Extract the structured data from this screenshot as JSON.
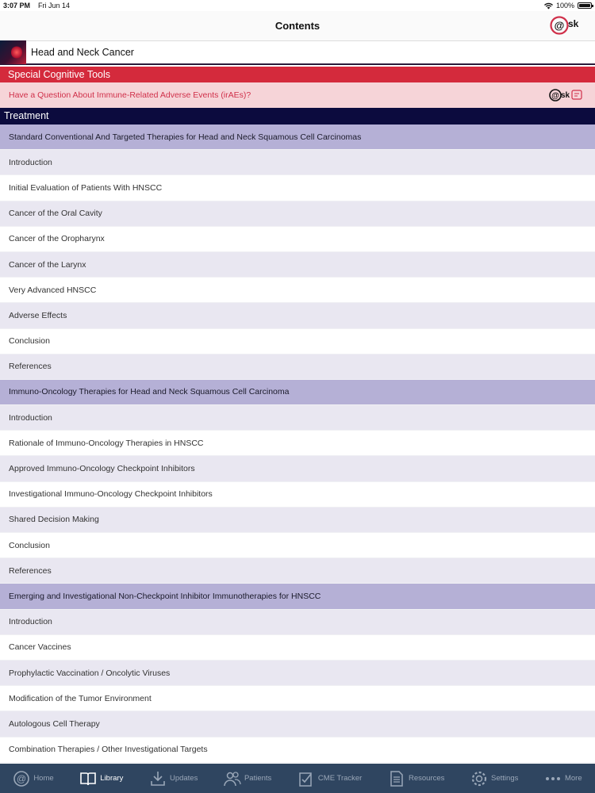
{
  "status": {
    "time": "3:07 PM",
    "date": "Fri Jun 14",
    "battery": "100%"
  },
  "nav": {
    "title": "Contents",
    "logo_text": "@sk"
  },
  "book": {
    "title": "Head and Neck Cancer"
  },
  "special_tools": {
    "header": "Special Cognitive Tools",
    "question": "Have a Question About Immune-Related Adverse Events (irAEs)?",
    "logo_text": "@sk"
  },
  "treatment": {
    "header": "Treatment"
  },
  "toc": [
    {
      "label": "Standard Conventional And Targeted Therapies for Head and Neck Squamous Cell Carcinomas",
      "type": "section"
    },
    {
      "label": "Introduction",
      "type": "alt"
    },
    {
      "label": "Initial Evaluation of Patients With HNSCC",
      "type": "plain"
    },
    {
      "label": "Cancer of the Oral Cavity",
      "type": "alt"
    },
    {
      "label": "Cancer of the Oropharynx",
      "type": "plain"
    },
    {
      "label": "Cancer of the Larynx",
      "type": "alt"
    },
    {
      "label": "Very Advanced HNSCC",
      "type": "plain"
    },
    {
      "label": "Adverse Effects",
      "type": "alt"
    },
    {
      "label": "Conclusion",
      "type": "plain"
    },
    {
      "label": "References",
      "type": "alt"
    },
    {
      "label": "Immuno-Oncology Therapies for Head and Neck Squamous Cell Carcinoma",
      "type": "section"
    },
    {
      "label": "Introduction",
      "type": "alt"
    },
    {
      "label": "Rationale of Immuno-Oncology Therapies in HNSCC",
      "type": "plain"
    },
    {
      "label": "Approved Immuno-Oncology Checkpoint Inhibitors",
      "type": "alt"
    },
    {
      "label": "Investigational Immuno-Oncology Checkpoint Inhibitors",
      "type": "plain"
    },
    {
      "label": "Shared Decision Making",
      "type": "alt"
    },
    {
      "label": "Conclusion",
      "type": "plain"
    },
    {
      "label": "References",
      "type": "alt"
    },
    {
      "label": "Emerging and Investigational Non-Checkpoint Inhibitor Immunotherapies for HNSCC",
      "type": "section"
    },
    {
      "label": "Introduction",
      "type": "alt"
    },
    {
      "label": "Cancer Vaccines",
      "type": "plain"
    },
    {
      "label": "Prophylactic Vaccination / Oncolytic Viruses",
      "type": "alt"
    },
    {
      "label": "Modification of the Tumor Environment",
      "type": "plain"
    },
    {
      "label": "Autologous Cell Therapy",
      "type": "alt"
    },
    {
      "label": "Combination Therapies / Other Investigational Targets",
      "type": "plain"
    }
  ],
  "tabs": [
    {
      "label": "Home",
      "icon": "at-home-icon",
      "active": false
    },
    {
      "label": "Library",
      "icon": "book-icon",
      "active": true
    },
    {
      "label": "Updates",
      "icon": "download-icon",
      "active": false
    },
    {
      "label": "Patients",
      "icon": "patients-icon",
      "active": false
    },
    {
      "label": "CME Tracker",
      "icon": "cme-tracker-icon",
      "active": false
    },
    {
      "label": "Resources",
      "icon": "document-icon",
      "active": false
    },
    {
      "label": "Settings",
      "icon": "gear-icon",
      "active": false
    },
    {
      "label": "More",
      "icon": "more-icon",
      "active": false
    }
  ],
  "colors": {
    "special_header": "#d42a3c",
    "special_row": "#f6d4d8",
    "treatment_header": "#0c0b3e",
    "section_row": "#b5b0d6",
    "alt_row": "#e9e7f1",
    "tab_bar": "#2f4560"
  }
}
